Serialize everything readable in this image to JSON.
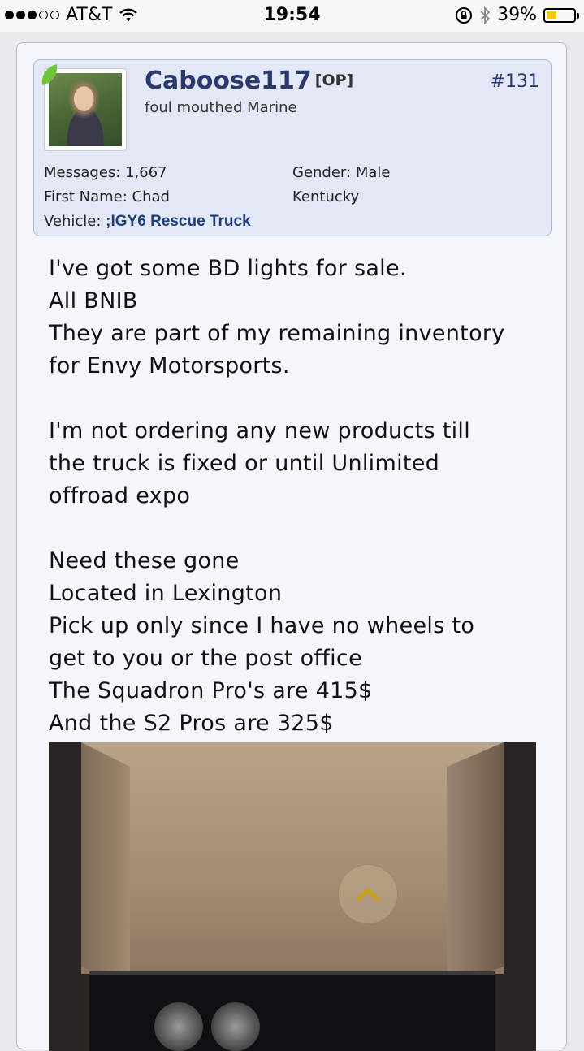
{
  "status_bar": {
    "carrier": "AT&T",
    "time": "19:54",
    "battery": "39%",
    "battery_level": 0.39,
    "signal_bars_filled": 3,
    "signal_bars_total": 5
  },
  "post": {
    "username": "Caboose117",
    "op_tag": "[OP]",
    "post_number": "#131",
    "user_title": "foul mouthed Marine",
    "messages_label": "Messages:",
    "messages_value": "1,667",
    "gender_label": "Gender:",
    "gender_value": "Male",
    "first_name_label": "First Name:",
    "first_name_value": "Chad",
    "location": "Kentucky",
    "vehicle_label": "Vehicle:",
    "vehicle_value": ";IGY6 Rescue Truck",
    "body": {
      "p1": [
        "I've got some BD lights for sale.",
        "All BNIB",
        "They are part of my remaining inventory",
        "for Envy Motorsports."
      ],
      "p2": [
        "I'm not ordering any new products till",
        "the truck is fixed or until Unlimited",
        "offroad expo"
      ],
      "p3": [
        "Need these gone",
        "Located in Lexington",
        "Pick up only since I have no wheels to",
        "get to you or the post office",
        "The Squadron Pro's are 415$",
        "And the S2 Pros are 325$"
      ]
    }
  },
  "colors": {
    "username": "#2b3a6e",
    "userinfo_bg": "#e4e8f6",
    "post_bg": "#f5f6fc",
    "online_flag": "#6fc63a",
    "battery_fill": "#f5c518"
  },
  "icons": [
    "wifi-icon",
    "rotation-lock-icon",
    "bluetooth-icon",
    "battery-icon",
    "scroll-to-top-icon"
  ]
}
